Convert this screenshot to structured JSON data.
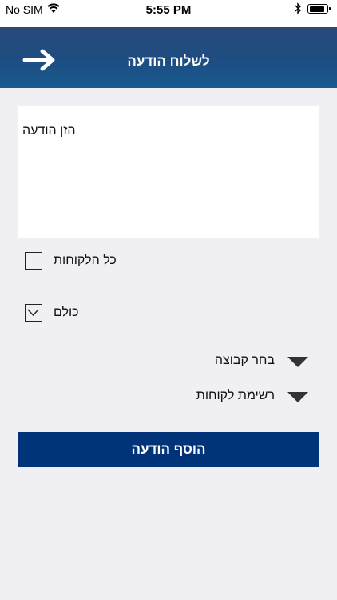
{
  "status_bar": {
    "carrier": "No SIM",
    "time": "5:55 PM",
    "battery_level": 0.9,
    "icons": [
      "wifi-icon",
      "bluetooth-icon",
      "battery-icon"
    ]
  },
  "header": {
    "title": "לשלוח הודעה",
    "back_icon": "arrow-right-icon",
    "background_color": "#1e4c80"
  },
  "message": {
    "placeholder": "הזן הודעה",
    "value": ""
  },
  "options": {
    "all_customers_label": "כל הלקוחות",
    "all_customers_checked": false,
    "everyone_label": "כולם",
    "everyone_checked": true
  },
  "dropdowns": {
    "group_label": "בחר קבוצה",
    "customer_list_label": "רשימת לקוחות"
  },
  "actions": {
    "add_message_label": "הוסף הודעה",
    "button_color": "#003377"
  }
}
